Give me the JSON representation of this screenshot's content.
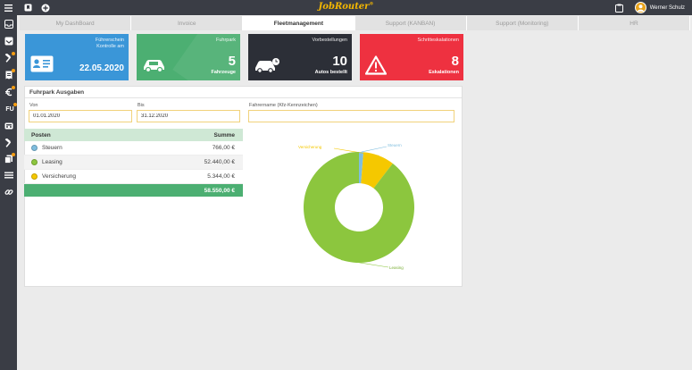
{
  "app": {
    "brand": "JobRouter",
    "brand_mark": "®"
  },
  "user": {
    "name": "Werner Schulz"
  },
  "tabs": [
    {
      "label": "My DashBoard",
      "active": false
    },
    {
      "label": "Invoice",
      "active": false
    },
    {
      "label": "Fleetmanagement",
      "active": true
    },
    {
      "label": "Support (KANBAN)",
      "active": false
    },
    {
      "label": "Support (Monitoring)",
      "active": false
    },
    {
      "label": "HR",
      "active": false
    }
  ],
  "sidebar": {
    "text_item": "FU"
  },
  "cards": [
    {
      "label_line1": "Führerschein",
      "label_line2": "Kontrolle am",
      "value": "22.05.2020",
      "sub": "",
      "color": "#3a96d8",
      "icon": "id-card-icon"
    },
    {
      "label_line1": "Fuhrpark",
      "label_line2": "",
      "value": "5",
      "sub": "Fahrzeuge",
      "color": "#4caf72",
      "icon": "car-icon"
    },
    {
      "label_line1": "Vorbestellungen",
      "label_line2": "",
      "value": "10",
      "sub": "Autos bestellt",
      "color": "#2c2f37",
      "icon": "car-clock-icon"
    },
    {
      "label_line1": "Schritteskalationen",
      "label_line2": "",
      "value": "8",
      "sub": "Eskalationen",
      "color": "#ee3140",
      "icon": "warning-icon"
    }
  ],
  "panel": {
    "title": "Fuhrpark Ausgaben",
    "von_label": "Von",
    "von_value": "01.01.2020",
    "bis_label": "Bis",
    "bis_value": "31.12.2020",
    "fahrer_label": "Fahrername (Kfz-Kennzeichen)",
    "fahrer_value": ""
  },
  "table": {
    "header": {
      "posten": "Posten",
      "summe": "Summe"
    },
    "rows": [
      {
        "label": "Steuern",
        "value": "766,00 €",
        "color": "#7fbedf"
      },
      {
        "label": "Leasing",
        "value": "52.440,00 €",
        "color": "#8cc63e"
      },
      {
        "label": "Versicherung",
        "value": "5.344,00 €",
        "color": "#f5c800"
      }
    ],
    "total": "58.550,00 €"
  },
  "chart_data": {
    "type": "pie",
    "donut": true,
    "labels": [
      "Steuern",
      "Versicherung",
      "Leasing"
    ],
    "values": [
      766,
      5344,
      52440
    ],
    "colors": [
      "#7fbedf",
      "#f5c800",
      "#8cc63e"
    ],
    "legend": "none",
    "data_labels": "outside"
  }
}
